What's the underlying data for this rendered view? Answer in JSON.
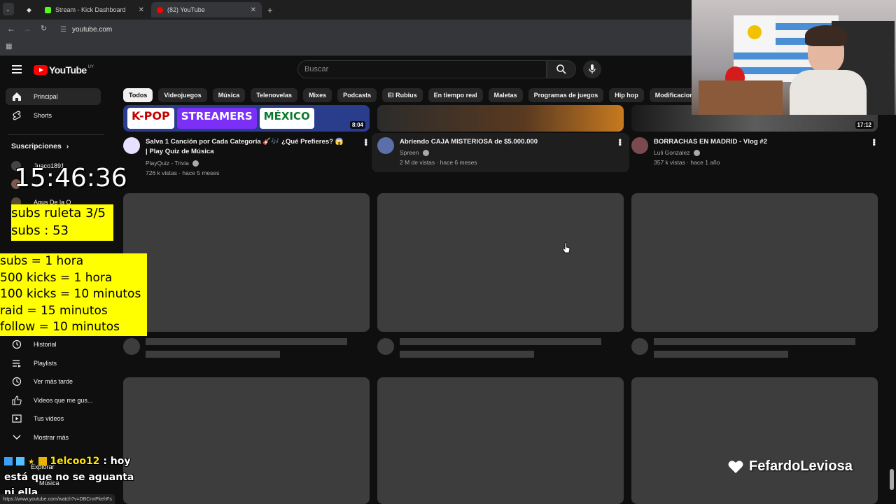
{
  "browser": {
    "tabs": [
      {
        "title": "Stream - Kick Dashboard",
        "fav_color": "#53fc18"
      },
      {
        "title": "(82) YouTube",
        "fav_color": "#ff0000"
      }
    ],
    "url": "youtube.com",
    "new_tab_icon": "plus-icon"
  },
  "header": {
    "logo_text": "YouTube",
    "country_code": "UY",
    "search_placeholder": "Buscar"
  },
  "chips": [
    "Todos",
    "Videojuegos",
    "Música",
    "Telenovelas",
    "Mixes",
    "Podcasts",
    "El Rubius",
    "En tiempo real",
    "Maletas",
    "Programas de juegos",
    "Hip hop",
    "Modificaciones"
  ],
  "sidebar": {
    "home": "Principal",
    "shorts": "Shorts",
    "subs_header": "Suscripciones",
    "channels": [
      "Juaco1891",
      "Agus De la O"
    ],
    "library": [
      {
        "label": "Historial",
        "icon": "history-icon"
      },
      {
        "label": "Playlists",
        "icon": "playlist-icon"
      },
      {
        "label": "Ver más tarde",
        "icon": "clock-icon"
      },
      {
        "label": "Videos que me gus...",
        "icon": "thumbs-up-icon"
      },
      {
        "label": "Tus videos",
        "icon": "video-icon"
      },
      {
        "label": "Mostrar más",
        "icon": "chevron-down-icon"
      }
    ],
    "explore": "Explorar",
    "music": "Música"
  },
  "videos": [
    {
      "title_line1": "Salva 1 Canción por Cada Categoría 🎸🎶 ¿Qué Prefieres? 😱",
      "title_line2": "| Play Quiz de Música",
      "channel": "PlayQuiz - Trivia",
      "meta": "726 k vistas · hace 5 meses",
      "duration": "8:04",
      "thumb_words": [
        "K-POP",
        "STREAMERS",
        "MÉXICO"
      ]
    },
    {
      "title_line1": "Abriendo CAJA MISTERIOSA de $5.000.000",
      "channel": "Spreen",
      "meta": "2 M de vistas · hace 6 meses"
    },
    {
      "title_line1": "BORRACHAS EN MADRID - Vlog #2",
      "channel": "Luli Gonzalez",
      "meta": "357 k vistas · hace 1 año",
      "duration": "17:12"
    }
  ],
  "overlay": {
    "clock": "15:46:36",
    "subs_box": [
      "subs ruleta 3/5",
      "subs : 53"
    ],
    "rules": [
      "subs = 1 hora",
      "500 kicks = 1 hora",
      "100 kicks = 10 minutos",
      "raid = 15 minutos",
      "follow = 10 minutos"
    ],
    "chat_user": "1elcoo12",
    "chat_message": ": hoy está que no se aguanta ni ella",
    "watermark": "FefardoLeviosa"
  },
  "status_url": "https://www.youtube.com/watch?v=DBCnnPkehFs",
  "colors": {
    "youtube_red": "#ff0000",
    "overlay_yellow": "#ffff00",
    "kick_green": "#53fc18"
  }
}
